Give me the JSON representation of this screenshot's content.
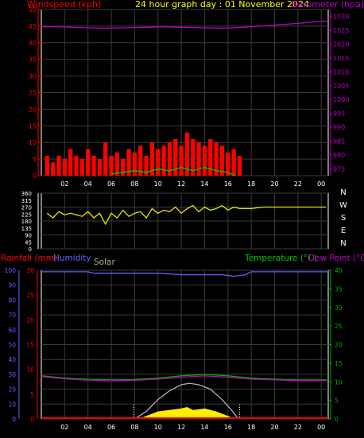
{
  "colors": {
    "wind": "#ff0000",
    "gust_area": "#ff0000",
    "wind_avg": "#00c000",
    "baro": "#c000c0",
    "dir": "#e8e800",
    "rain": "#ff0000",
    "humidity": "#6060ff",
    "solar": "#ffee00",
    "solar_theory": "#b0b0b0",
    "temp": "#00b000",
    "dew": "#c000c0",
    "grid": "#3a3a3a",
    "frame": "#ffffff",
    "ticks": "#ffffff"
  },
  "chart_data": [
    {
      "type": "line",
      "title": "24 hour graph day : 01 November 2024",
      "left_axis_label": "Windspeed (kph)",
      "right_axis_label": "Barometer (hpa)",
      "x_ticks": [
        "02",
        "04",
        "06",
        "08",
        "10",
        "12",
        "14",
        "16",
        "18",
        "20",
        "22",
        "00"
      ],
      "x_range": [
        0,
        24.6
      ],
      "left_range": [
        0,
        50
      ],
      "left_ticks": [
        "0",
        "5",
        "10",
        "15",
        "20",
        "25",
        "30",
        "35",
        "40",
        "45",
        "50"
      ],
      "right_range": [
        972.5,
        1032.5
      ],
      "right_ticks": [
        "975",
        "980",
        "985",
        "990",
        "995",
        "1000",
        "1005",
        "1010",
        "1015",
        "1020",
        "1025",
        "1030"
      ],
      "series": [
        {
          "name": "Barometer",
          "axis": "right",
          "x": [
            0,
            1,
            2,
            3,
            4,
            5,
            6,
            7,
            8,
            9,
            10,
            11,
            12,
            13,
            14,
            15,
            16,
            17,
            18,
            19,
            20,
            21,
            22,
            23,
            24.5
          ],
          "y": [
            1026.3,
            1026.3,
            1026.2,
            1026.0,
            1025.9,
            1025.8,
            1025.8,
            1025.9,
            1026.0,
            1026.1,
            1026.2,
            1026.2,
            1026.1,
            1026.0,
            1025.9,
            1025.8,
            1025.8,
            1026.0,
            1026.3,
            1026.6,
            1026.9,
            1027.2,
            1027.5,
            1027.9,
            1028.3
          ]
        },
        {
          "name": "Windspeed",
          "axis": "left",
          "x": [
            0.5,
            1.0,
            1.5,
            2.0,
            2.5,
            3.0,
            3.5,
            4.0,
            4.5,
            5.0,
            5.5,
            6.0,
            6.5,
            7.0,
            7.5,
            8.0,
            8.5,
            9.0,
            9.5,
            10.0,
            10.5,
            11.0,
            11.5,
            12.0,
            12.5,
            13.0,
            13.5,
            14.0,
            14.5,
            15.0,
            15.5,
            16.0,
            16.5,
            17.0
          ],
          "y": [
            6,
            4,
            6,
            5,
            8,
            6,
            5,
            8,
            6,
            5,
            10,
            6,
            7,
            5,
            8,
            7,
            9,
            6,
            10,
            8,
            9,
            10,
            11,
            9,
            13,
            11,
            10,
            9,
            11,
            10,
            9,
            7,
            8,
            6
          ]
        },
        {
          "name": "Wind average",
          "axis": "left",
          "x": [
            6,
            7,
            8,
            9,
            10,
            11,
            12,
            13,
            14,
            15,
            16,
            16.6
          ],
          "y": [
            0.5,
            1,
            1.5,
            1,
            2,
            1.5,
            2.5,
            1.5,
            2.5,
            1.5,
            1,
            0
          ]
        }
      ]
    },
    {
      "type": "line",
      "title": "",
      "left_range": [
        0,
        360
      ],
      "left_ticks": [
        "0",
        "45",
        "90",
        "135",
        "180",
        "225",
        "270",
        "315",
        "360"
      ],
      "direction_labels": [
        "N",
        "W",
        "S",
        "E",
        "N"
      ],
      "series": [
        {
          "name": "Wind direction",
          "x": [
            0.5,
            1.0,
            1.5,
            2.0,
            2.5,
            3.0,
            3.5,
            4.0,
            4.5,
            5.0,
            5.5,
            6.0,
            6.5,
            7.0,
            7.5,
            8.0,
            8.5,
            9.0,
            9.5,
            10.0,
            10.5,
            11.0,
            11.5,
            12.0,
            12.5,
            13.0,
            13.5,
            14.0,
            14.5,
            15.0,
            15.5,
            16.0,
            16.5,
            17.0,
            18.0,
            19.0,
            20.0,
            21.0,
            22.0,
            23.0,
            24.4
          ],
          "y": [
            230,
            200,
            240,
            220,
            230,
            220,
            210,
            240,
            200,
            230,
            160,
            230,
            200,
            250,
            210,
            230,
            240,
            200,
            260,
            230,
            250,
            240,
            270,
            230,
            260,
            280,
            240,
            270,
            250,
            260,
            280,
            250,
            270,
            260,
            260,
            270,
            270,
            270,
            270,
            270,
            270
          ]
        }
      ]
    },
    {
      "type": "line",
      "title": "",
      "labels": {
        "rain": "Rainfall (mm)",
        "humidity": "Humidity",
        "solar": "Solar",
        "temp": "Temperature (°C)",
        "dew": "Dew Point (°C)"
      },
      "x_ticks": [
        "02",
        "04",
        "06",
        "08",
        "10",
        "12",
        "14",
        "16",
        "18",
        "20",
        "22",
        "00"
      ],
      "humidity_range": [
        0,
        100
      ],
      "humidity_ticks": [
        "0",
        "10",
        "20",
        "30",
        "40",
        "50",
        "60",
        "70",
        "80",
        "90",
        "100"
      ],
      "rain_range": [
        0,
        30
      ],
      "rain_ticks": [
        "0",
        "5",
        "10",
        "15",
        "20",
        "25",
        "30"
      ],
      "temp_range": [
        0,
        40
      ],
      "temp_ticks": [
        "0",
        "5",
        "10",
        "15",
        "20",
        "25",
        "30",
        "35",
        "40"
      ],
      "series": [
        {
          "name": "Humidity",
          "axis": "humidity",
          "x": [
            0,
            4,
            4.5,
            8,
            10,
            12,
            14,
            15.5,
            16.5,
            17.5,
            18,
            24.5
          ],
          "y": [
            99,
            99,
            98,
            98,
            98,
            97,
            97,
            97,
            96,
            97,
            99,
            99
          ]
        },
        {
          "name": "Temperature",
          "axis": "temp",
          "x": [
            0,
            2,
            4,
            6,
            8,
            10,
            12,
            14,
            16,
            18,
            20,
            22,
            24.5
          ],
          "y": [
            11.6,
            11.0,
            10.7,
            10.5,
            10.6,
            11.0,
            11.6,
            12.0,
            11.6,
            11.0,
            10.7,
            10.5,
            10.5
          ]
        },
        {
          "name": "Dew Point",
          "axis": "temp",
          "x": [
            0,
            2,
            4,
            6,
            8,
            10,
            12,
            14,
            16,
            18,
            20,
            22,
            24.5
          ],
          "y": [
            11.4,
            10.8,
            10.4,
            10.3,
            10.4,
            10.7,
            11.2,
            11.6,
            11.2,
            10.7,
            10.5,
            10.3,
            10.3
          ]
        },
        {
          "name": "Solar theoretical",
          "axis": "humidity",
          "x": [
            8.0,
            9.0,
            10.0,
            11.0,
            12.0,
            12.7,
            13.5,
            14.5,
            15.5,
            16.3,
            16.9
          ],
          "y": [
            0,
            5,
            13,
            19,
            23,
            24,
            23,
            20,
            13,
            6,
            0
          ]
        },
        {
          "name": "Solar",
          "axis": "humidity",
          "x": [
            8.3,
            9.0,
            10.0,
            11.0,
            12.0,
            12.5,
            13.0,
            14.0,
            15.0,
            16.0,
            16.6
          ],
          "y": [
            0,
            2,
            5,
            6,
            7,
            8,
            6,
            7,
            5,
            2,
            0
          ]
        }
      ]
    }
  ]
}
